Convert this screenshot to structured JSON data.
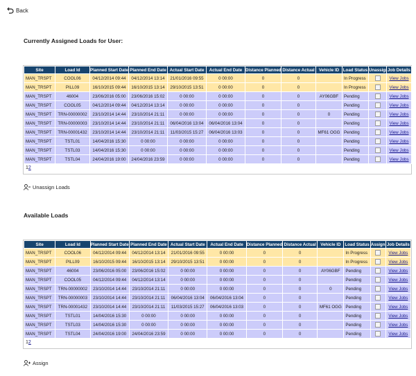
{
  "back_label": "Back",
  "assigned": {
    "title": "Currently Assigned Loads for User:",
    "columns": [
      "Site",
      "Load Id",
      "Planned Start Date",
      "Planned End Date",
      "Actual Start Date",
      "Actual End Date",
      "Distance Planned",
      "Distance Actual",
      "Vehicle ID",
      "Load Status",
      "Unassign",
      "Job Details"
    ],
    "rows": [
      {
        "site": "MAN_TRSPT",
        "load_id": "COOL06",
        "planned_start": "04/12/2014 09:44",
        "planned_end": "04/12/2014 13:14",
        "actual_start": "21/01/2016 09:55",
        "actual_end": "0 00:00",
        "dist_planned": "0",
        "dist_actual": "0",
        "vehicle": "",
        "status": "In Progress",
        "job": "View Jobs",
        "color": "yellow"
      },
      {
        "site": "MAN_TRSPT",
        "load_id": "PILL09",
        "planned_start": "16/10/2015 09:44",
        "planned_end": "16/10/2015 13:14",
        "actual_start": "29/10/2015 13:51",
        "actual_end": "0 00:00",
        "dist_planned": "0",
        "dist_actual": "0",
        "vehicle": "",
        "status": "In Progress",
        "job": "View Jobs",
        "color": "yellow"
      },
      {
        "site": "MAN_TRSPT",
        "load_id": "46004",
        "planned_start": "23/06/2016 05:00",
        "planned_end": "23/06/2016 15:02",
        "actual_start": "0 00:00",
        "actual_end": "0 00:00",
        "dist_planned": "0",
        "dist_actual": "0",
        "vehicle": "AY06GBF",
        "status": "Pending",
        "job": "View Jobs",
        "color": "blue"
      },
      {
        "site": "MAN_TRSPT",
        "load_id": "COOL05",
        "planned_start": "04/12/2014 09:44",
        "planned_end": "04/12/2014 13:14",
        "actual_start": "0 00:00",
        "actual_end": "0 00:00",
        "dist_planned": "0",
        "dist_actual": "0",
        "vehicle": "",
        "status": "Pending",
        "job": "View Jobs",
        "color": "blue"
      },
      {
        "site": "MAN_TRSPT",
        "load_id": "TRN-00000002",
        "planned_start": "23/10/2014 14:44",
        "planned_end": "23/10/2014 21:11",
        "actual_start": "0 00:00",
        "actual_end": "0 00:00",
        "dist_planned": "0",
        "dist_actual": "0",
        "vehicle": "0",
        "status": "Pending",
        "job": "View Jobs",
        "color": "blue"
      },
      {
        "site": "MAN_TRSPT",
        "load_id": "TRN-00000003",
        "planned_start": "23/10/2014 14:44",
        "planned_end": "23/10/2014 21:11",
        "actual_start": "06/04/2016 13:04",
        "actual_end": "06/04/2016 13:04",
        "dist_planned": "0",
        "dist_actual": "0",
        "vehicle": "",
        "status": "Pending",
        "job": "View Jobs",
        "color": "blue"
      },
      {
        "site": "MAN_TRSPT",
        "load_id": "TRN-00001432",
        "planned_start": "23/10/2014 14:44",
        "planned_end": "23/10/2014 21:11",
        "actual_start": "11/03/2015 15:27",
        "actual_end": "06/04/2016 13:03",
        "dist_planned": "0",
        "dist_actual": "0",
        "vehicle": "MF61 OGG",
        "status": "Pending",
        "job": "View Jobs",
        "color": "blue"
      },
      {
        "site": "MAN_TRSPT",
        "load_id": "TSTL01",
        "planned_start": "14/04/2016 15:30",
        "planned_end": "0 00:00",
        "actual_start": "0 00:00",
        "actual_end": "0 00:00",
        "dist_planned": "0",
        "dist_actual": "0",
        "vehicle": "",
        "status": "Pending",
        "job": "View Jobs",
        "color": "blue"
      },
      {
        "site": "MAN_TRSPT",
        "load_id": "TSTL03",
        "planned_start": "14/04/2016 15:30",
        "planned_end": "0 00:00",
        "actual_start": "0 00:00",
        "actual_end": "0 00:00",
        "dist_planned": "0",
        "dist_actual": "0",
        "vehicle": "",
        "status": "Pending",
        "job": "View Jobs",
        "color": "blue"
      },
      {
        "site": "MAN_TRSPT",
        "load_id": "TSTL04",
        "planned_start": "24/04/2016 19:00",
        "planned_end": "24/04/2016 23:59",
        "actual_start": "0 00:00",
        "actual_end": "0 00:00",
        "dist_planned": "0",
        "dist_actual": "0",
        "vehicle": "",
        "status": "Pending",
        "job": "View Jobs",
        "color": "blue"
      }
    ],
    "pager": {
      "current": "1",
      "next": "2"
    },
    "action_label": "Unassign Loads"
  },
  "available": {
    "title": "Available Loads",
    "columns": [
      "Site",
      "Load Id",
      "Planned Start Date",
      "Planned End Date",
      "Actual Start Date",
      "Actual End Date",
      "Distance Planned",
      "Distance Actual",
      "Vehicle ID",
      "Load Status",
      "Assign",
      "Job Details"
    ],
    "rows": [
      {
        "site": "MAN_TRSPT",
        "load_id": "COOL06",
        "planned_start": "04/12/2014 09:44",
        "planned_end": "04/12/2014 13:14",
        "actual_start": "21/01/2016 09:55",
        "actual_end": "0 00:00",
        "dist_planned": "0",
        "dist_actual": "0",
        "vehicle": "",
        "status": "In Progress",
        "job": "View Jobs",
        "color": "yellow"
      },
      {
        "site": "MAN_TRSPT",
        "load_id": "PILL09",
        "planned_start": "16/10/2015 09:44",
        "planned_end": "16/10/2015 13:14",
        "actual_start": "29/10/2015 13:51",
        "actual_end": "0 00:00",
        "dist_planned": "0",
        "dist_actual": "0",
        "vehicle": "",
        "status": "In Progress",
        "job": "View Jobs",
        "color": "yellow"
      },
      {
        "site": "MAN_TRSPT",
        "load_id": "46004",
        "planned_start": "23/06/2016 05:00",
        "planned_end": "23/06/2016 15:02",
        "actual_start": "0 00:00",
        "actual_end": "0 00:00",
        "dist_planned": "0",
        "dist_actual": "0",
        "vehicle": "AY06GBF",
        "status": "Pending",
        "job": "View Jobs",
        "color": "blue"
      },
      {
        "site": "MAN_TRSPT",
        "load_id": "COOL05",
        "planned_start": "04/12/2014 09:44",
        "planned_end": "04/12/2014 13:14",
        "actual_start": "0 00:00",
        "actual_end": "0 00:00",
        "dist_planned": "0",
        "dist_actual": "0",
        "vehicle": "",
        "status": "Pending",
        "job": "View Jobs",
        "color": "blue"
      },
      {
        "site": "MAN_TRSPT",
        "load_id": "TRN-00000002",
        "planned_start": "23/10/2014 14:44",
        "planned_end": "23/10/2014 21:11",
        "actual_start": "0 00:00",
        "actual_end": "0 00:00",
        "dist_planned": "0",
        "dist_actual": "0",
        "vehicle": "0",
        "status": "Pending",
        "job": "View Jobs",
        "color": "blue"
      },
      {
        "site": "MAN_TRSPT",
        "load_id": "TRN-00000003",
        "planned_start": "23/10/2014 14:44",
        "planned_end": "23/10/2014 21:11",
        "actual_start": "06/04/2016 13:04",
        "actual_end": "06/04/2016 13:04",
        "dist_planned": "0",
        "dist_actual": "0",
        "vehicle": "",
        "status": "Pending",
        "job": "View Jobs",
        "color": "blue"
      },
      {
        "site": "MAN_TRSPT",
        "load_id": "TRN-00001432",
        "planned_start": "23/10/2014 14:44",
        "planned_end": "23/10/2014 21:11",
        "actual_start": "11/03/2015 15:27",
        "actual_end": "06/04/2016 13:03",
        "dist_planned": "0",
        "dist_actual": "0",
        "vehicle": "MF61 OGG",
        "status": "Pending",
        "job": "View Jobs",
        "color": "blue"
      },
      {
        "site": "MAN_TRSPT",
        "load_id": "TSTL01",
        "planned_start": "14/04/2016 15:30",
        "planned_end": "0 00:00",
        "actual_start": "0 00:00",
        "actual_end": "0 00:00",
        "dist_planned": "0",
        "dist_actual": "0",
        "vehicle": "",
        "status": "Pending",
        "job": "View Jobs",
        "color": "blue"
      },
      {
        "site": "MAN_TRSPT",
        "load_id": "TSTL03",
        "planned_start": "14/04/2016 15:30",
        "planned_end": "0 00:00",
        "actual_start": "0 00:00",
        "actual_end": "0 00:00",
        "dist_planned": "0",
        "dist_actual": "0",
        "vehicle": "",
        "status": "Pending",
        "job": "View Jobs",
        "color": "blue"
      },
      {
        "site": "MAN_TRSPT",
        "load_id": "TSTL04",
        "planned_start": "24/04/2016 19:00",
        "planned_end": "24/04/2016 23:59",
        "actual_start": "0 00:00",
        "actual_end": "0 00:00",
        "dist_planned": "0",
        "dist_actual": "0",
        "vehicle": "",
        "status": "Pending",
        "job": "View Jobs",
        "color": "blue"
      }
    ],
    "pager": {
      "current": "1",
      "next": "2"
    },
    "action_label": "Assign"
  },
  "colors": {
    "header": "#17446e",
    "row_yellow": "#ffe7a6",
    "row_blue": "#ccccfa",
    "link": "#1a1a8c"
  },
  "icons": {
    "back": "undo-arrow-icon",
    "unassign": "user-remove-icon",
    "assign": "user-add-icon"
  }
}
